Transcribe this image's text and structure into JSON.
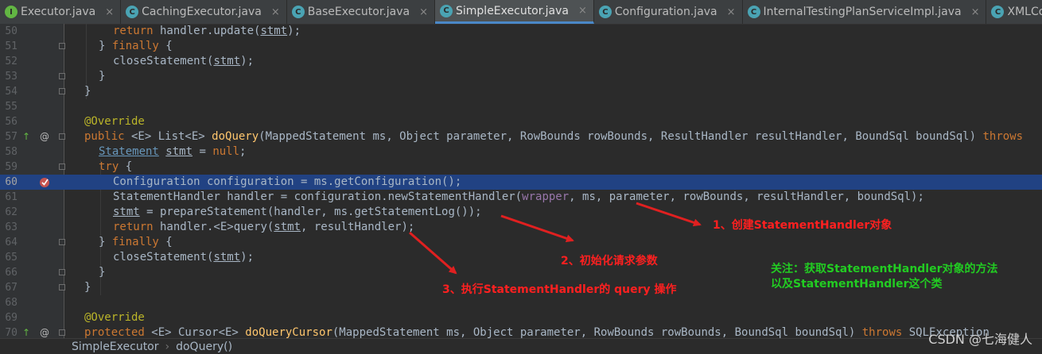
{
  "tabs": [
    {
      "label": "Executor.java",
      "icon": "interface-icon",
      "active": false
    },
    {
      "label": "CachingExecutor.java",
      "icon": "class-icon",
      "active": false
    },
    {
      "label": "BaseExecutor.java",
      "icon": "class-icon",
      "active": false
    },
    {
      "label": "SimpleExecutor.java",
      "icon": "class-icon",
      "active": true
    },
    {
      "label": "Configuration.java",
      "icon": "class-icon",
      "active": false
    },
    {
      "label": "InternalTestingPlanServiceImpl.java",
      "icon": "class-icon",
      "active": false
    },
    {
      "label": "XMLConfig",
      "icon": "class-icon",
      "active": false
    }
  ],
  "tab_close": "×",
  "line_numbers": [
    "50",
    "51",
    "52",
    "53",
    "54",
    "55",
    "56",
    "57",
    "58",
    "59",
    "60",
    "61",
    "62",
    "63",
    "64",
    "65",
    "66",
    "67",
    "68",
    "69",
    "70"
  ],
  "current_line": "60",
  "gutter_markers": {
    "override_up": "↑",
    "annotation_at": "@"
  },
  "code": {
    "l50_return": "return",
    "l50_rest": " handler.update(",
    "l50_var": "stmt",
    "l50_end": ");",
    "l51_brace": "} ",
    "l51_finally": "finally",
    "l51_end": " {",
    "l52_call": "closeStatement(",
    "l52_var": "stmt",
    "l52_end": ");",
    "l53": "}",
    "l54": "}",
    "l56": "@Override",
    "l57_public": "public",
    "l57_gen": " <E> List<E> ",
    "l57_fn": "doQuery",
    "l57_params": "(MappedStatement ms, Object parameter, RowBounds rowBounds, ResultHandler resultHandler, BoundSql boundSql) ",
    "l57_throws": "throws",
    "l58_type": "Statement",
    "l58_var": "stmt",
    "l58_eq": " = ",
    "l58_null": "null",
    "l58_end": ";",
    "l59_try": "try",
    "l59_end": " {",
    "l60": "Configuration configuration = ms.getConfiguration();",
    "l61_a": "StatementHandler handler = configuration.newStatementHandler(",
    "l61_wrapper": "wrapper",
    "l61_b": ", ms, parameter, rowBounds, resultHandler, boundSql);",
    "l62_var": "stmt",
    "l62_rest": " = prepareStatement(handler, ms.getStatementLog());",
    "l63_return": "return",
    "l63_a": " handler.<E>query(",
    "l63_var": "stmt",
    "l63_b": ", resultHandler);",
    "l64_brace": "} ",
    "l64_finally": "finally",
    "l64_end": " {",
    "l65_call": "closeStatement(",
    "l65_var": "stmt",
    "l65_end": ");",
    "l66": "}",
    "l67": "}",
    "l69": "@Override",
    "l70_protected": "protected",
    "l70_gen": " <E> Cursor<E> ",
    "l70_fn": "doQueryCursor",
    "l70_params": "(MappedStatement ms, Object parameter, RowBounds rowBounds, BoundSql boundSql) ",
    "l70_throws": "throws",
    "l70_tail": " SQLException"
  },
  "annotations": {
    "step1": "1、创建StatementHandler对象",
    "step2": "2、初始化请求参数",
    "step3": "3、执行StatementHandler的 query 操作",
    "note_line1": "关注：获取StatementHandler对象的方法",
    "note_line2": "以及StatementHandler这个类"
  },
  "breadcrumb": [
    "SimpleExecutor",
    "doQuery()"
  ],
  "breadcrumb_sep": "›",
  "watermark": "CSDN @七海健人",
  "colors": {
    "keyword": "#cc7832",
    "annotation": "#bbb529",
    "method": "#ffc66d",
    "field": "#9876aa",
    "selection": "#214283",
    "red_note": "#ff2020",
    "green_note": "#22cc22"
  }
}
